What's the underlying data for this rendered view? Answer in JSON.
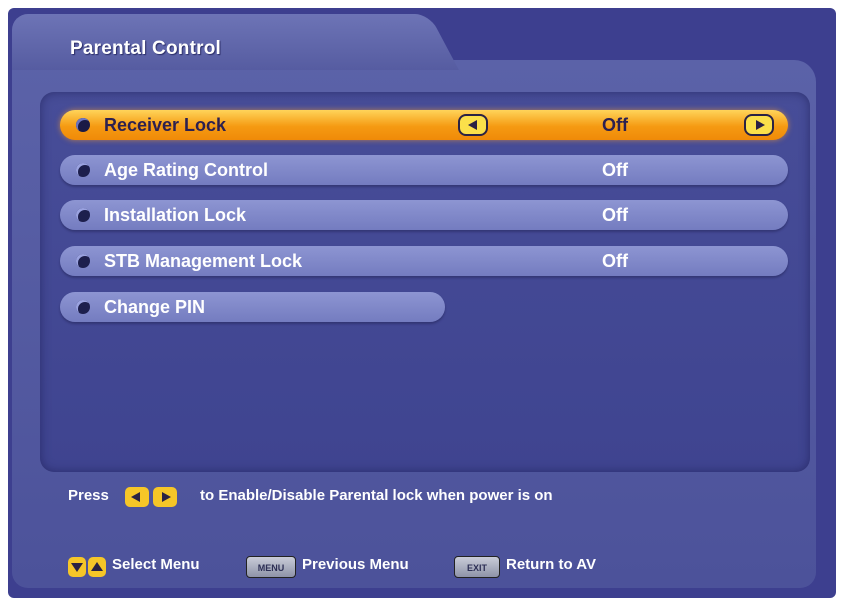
{
  "panel": {
    "title": "Parental Control"
  },
  "rows": [
    {
      "label": "Receiver Lock",
      "value": "Off",
      "selected": true
    },
    {
      "label": "Age Rating Control",
      "value": "Off"
    },
    {
      "label": "Installation Lock",
      "value": "Off"
    },
    {
      "label": "STB Management Lock",
      "value": "Off"
    },
    {
      "label": "Change PIN"
    }
  ],
  "hint": {
    "prefix": "Press",
    "text": "to Enable/Disable Parental lock when power is on"
  },
  "footer": {
    "select_label": "Select Menu",
    "menu_key": "MENU",
    "previous_label": "Previous Menu",
    "exit_key": "EXIT",
    "return_label": "Return to AV"
  },
  "colors": {
    "background": "#3d3f8f",
    "row": "#7f87c9",
    "selected_row": "#f59a12",
    "key_yellow": "#f6c628"
  }
}
